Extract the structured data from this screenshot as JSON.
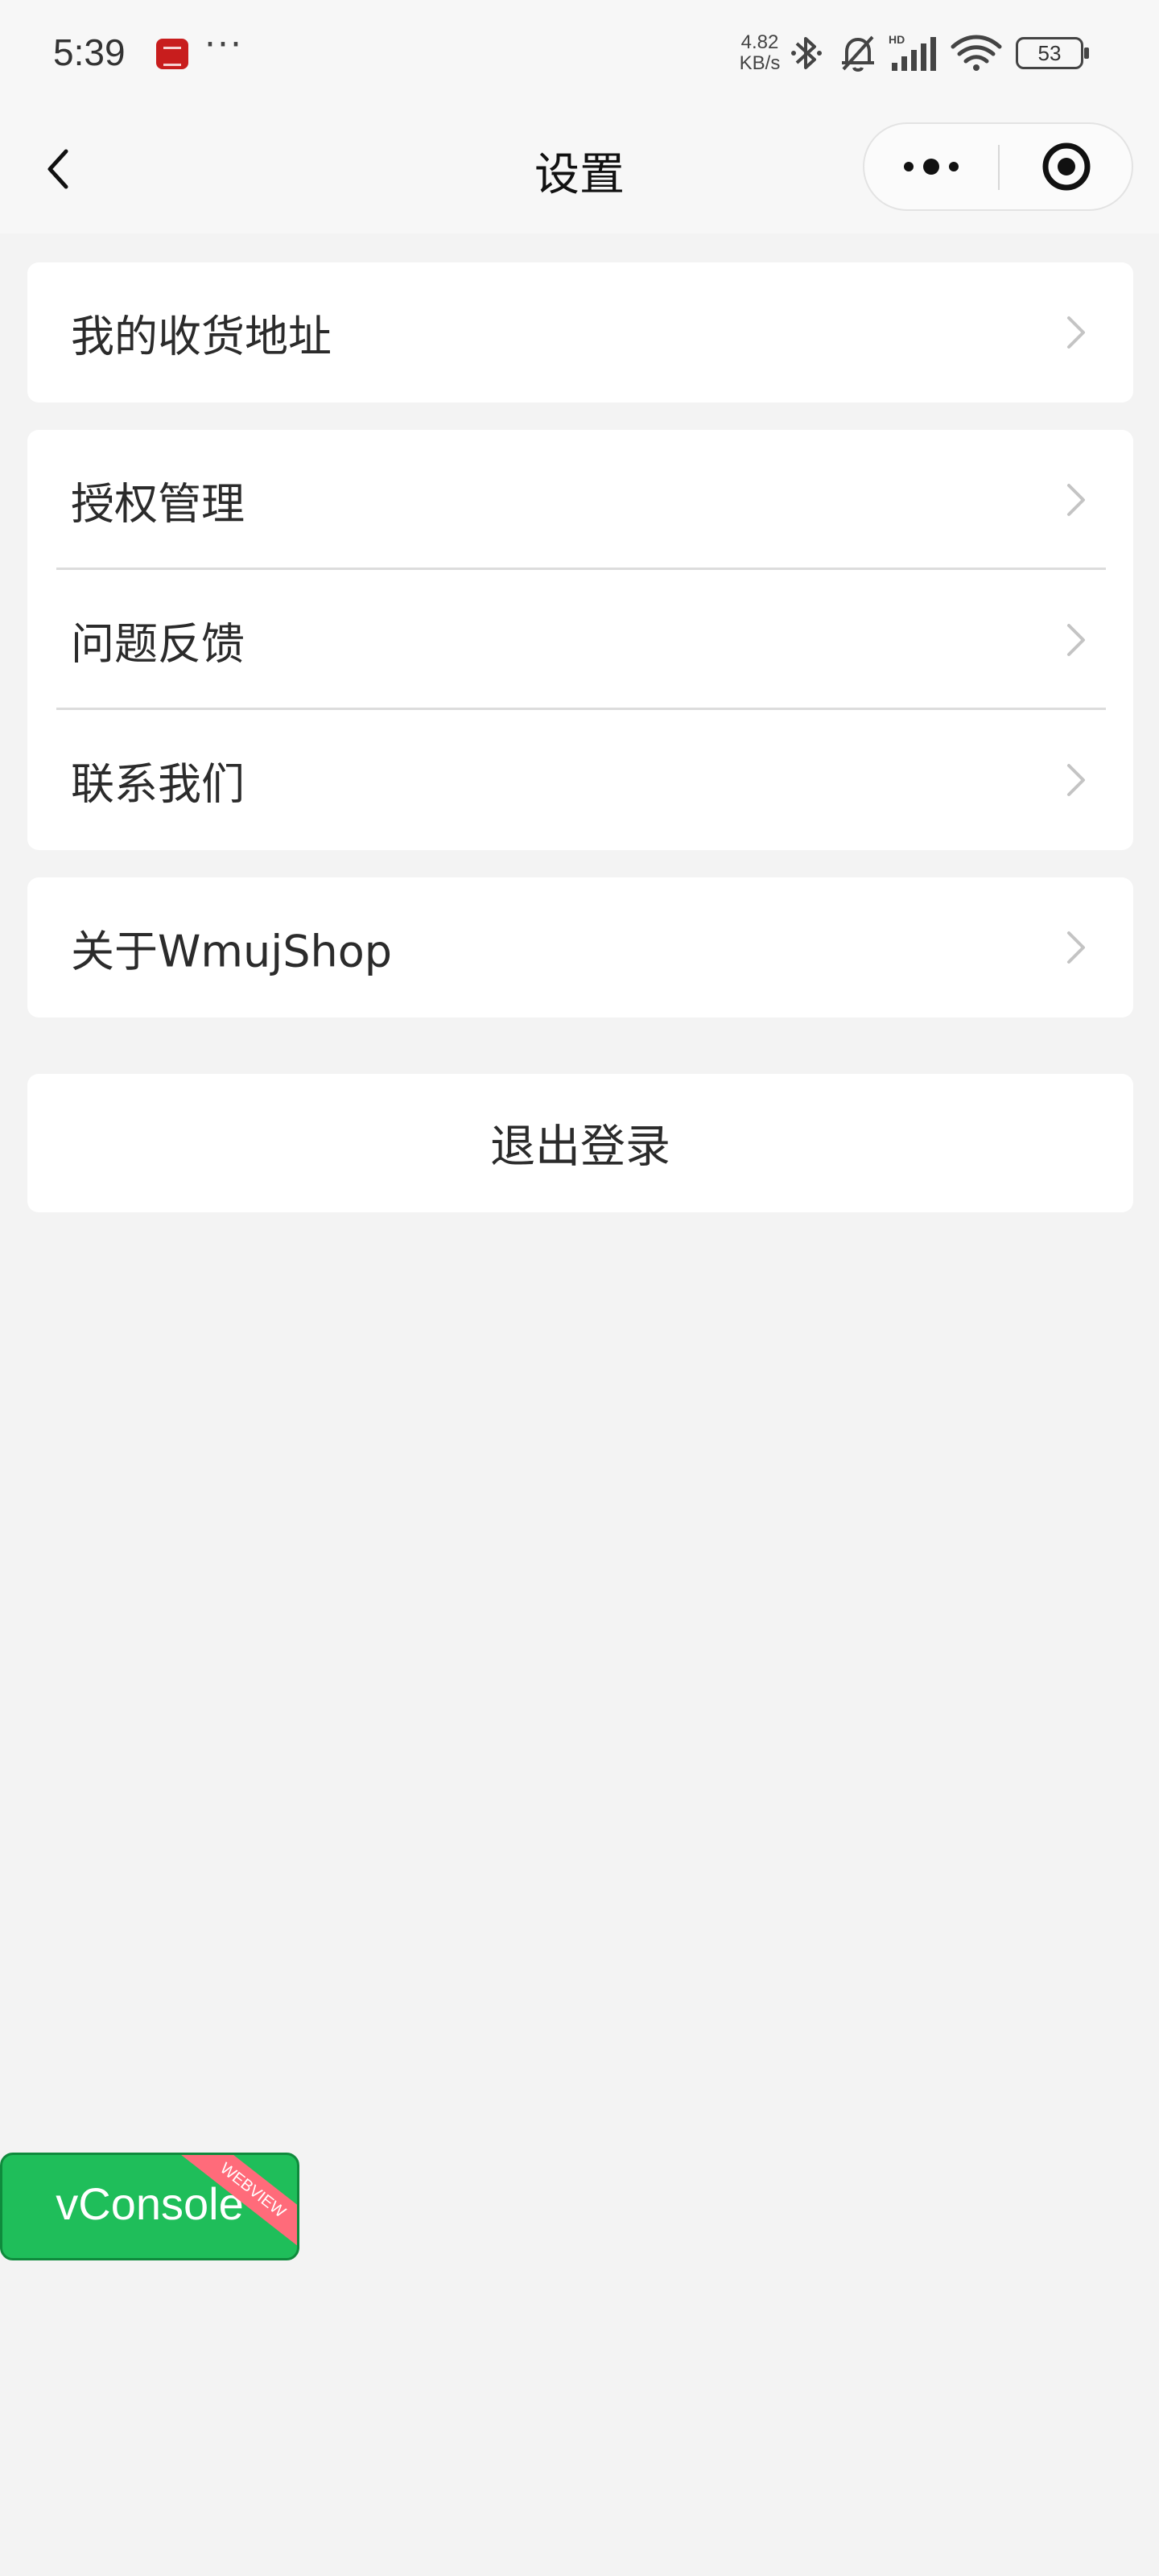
{
  "status_bar": {
    "time": "5:39",
    "dots": "···",
    "net_speed_value": "4.82",
    "net_speed_unit": "KB/s",
    "signal_tag": "HD",
    "battery": "53"
  },
  "nav": {
    "title": "设置"
  },
  "settings": {
    "group1": [
      {
        "label": "我的收货地址"
      }
    ],
    "group2": [
      {
        "label": "授权管理"
      },
      {
        "label": "问题反馈"
      },
      {
        "label": "联系我们"
      }
    ],
    "group3": [
      {
        "label": "关于WmujShop"
      }
    ],
    "logout_label": "退出登录"
  },
  "vconsole": {
    "label": "vConsole",
    "ribbon": "WEBVIEW"
  },
  "colors": {
    "page_background": "#f3f3f3",
    "card_background": "#ffffff",
    "vconsole_green": "#1fbe5a",
    "ribbon_pink": "#ff6b7a"
  },
  "icons": {
    "back": "chevron-left-icon",
    "more": "more-dots-icon",
    "close": "target-circle-icon",
    "row_arrow": "chevron-right-icon",
    "bluetooth": "bluetooth-icon",
    "mute": "bell-off-icon",
    "signal": "cell-signal-icon",
    "wifi": "wifi-icon",
    "battery": "battery-icon"
  }
}
